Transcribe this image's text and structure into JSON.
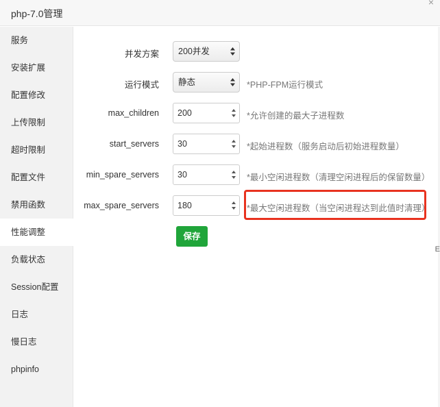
{
  "window": {
    "title": "php-7.0管理"
  },
  "sidebar": {
    "items": [
      {
        "label": "服务",
        "active": false
      },
      {
        "label": "安装扩展",
        "active": false
      },
      {
        "label": "配置修改",
        "active": false
      },
      {
        "label": "上传限制",
        "active": false
      },
      {
        "label": "超时限制",
        "active": false
      },
      {
        "label": "配置文件",
        "active": false
      },
      {
        "label": "禁用函数",
        "active": false
      },
      {
        "label": "性能调整",
        "active": true
      },
      {
        "label": "负载状态",
        "active": false
      },
      {
        "label": "Session配置",
        "active": false
      },
      {
        "label": "日志",
        "active": false
      },
      {
        "label": "慢日志",
        "active": false
      },
      {
        "label": "phpinfo",
        "active": false
      }
    ]
  },
  "form": {
    "concurrency": {
      "label": "并发方案",
      "value": "200并发",
      "hint": ""
    },
    "run_mode": {
      "label": "运行模式",
      "value": "静态",
      "hint": "*PHP-FPM运行模式"
    },
    "max_children": {
      "label": "max_children",
      "value": "200",
      "hint": "*允许创建的最大子进程数"
    },
    "start_servers": {
      "label": "start_servers",
      "value": "30",
      "hint": "*起始进程数（服务启动后初始进程数量）"
    },
    "min_spare_servers": {
      "label": "min_spare_servers",
      "value": "30",
      "hint": "*最小空闲进程数（清理空闲进程后的保留数量）"
    },
    "max_spare_servers": {
      "label": "max_spare_servers",
      "value": "180",
      "hint": "*最大空闲进程数（当空闲进程达到此值时清理）"
    },
    "save_label": "保存"
  },
  "edge_glyph": "E",
  "colors": {
    "accent": "#20a53a",
    "highlight": "#e8321f"
  }
}
